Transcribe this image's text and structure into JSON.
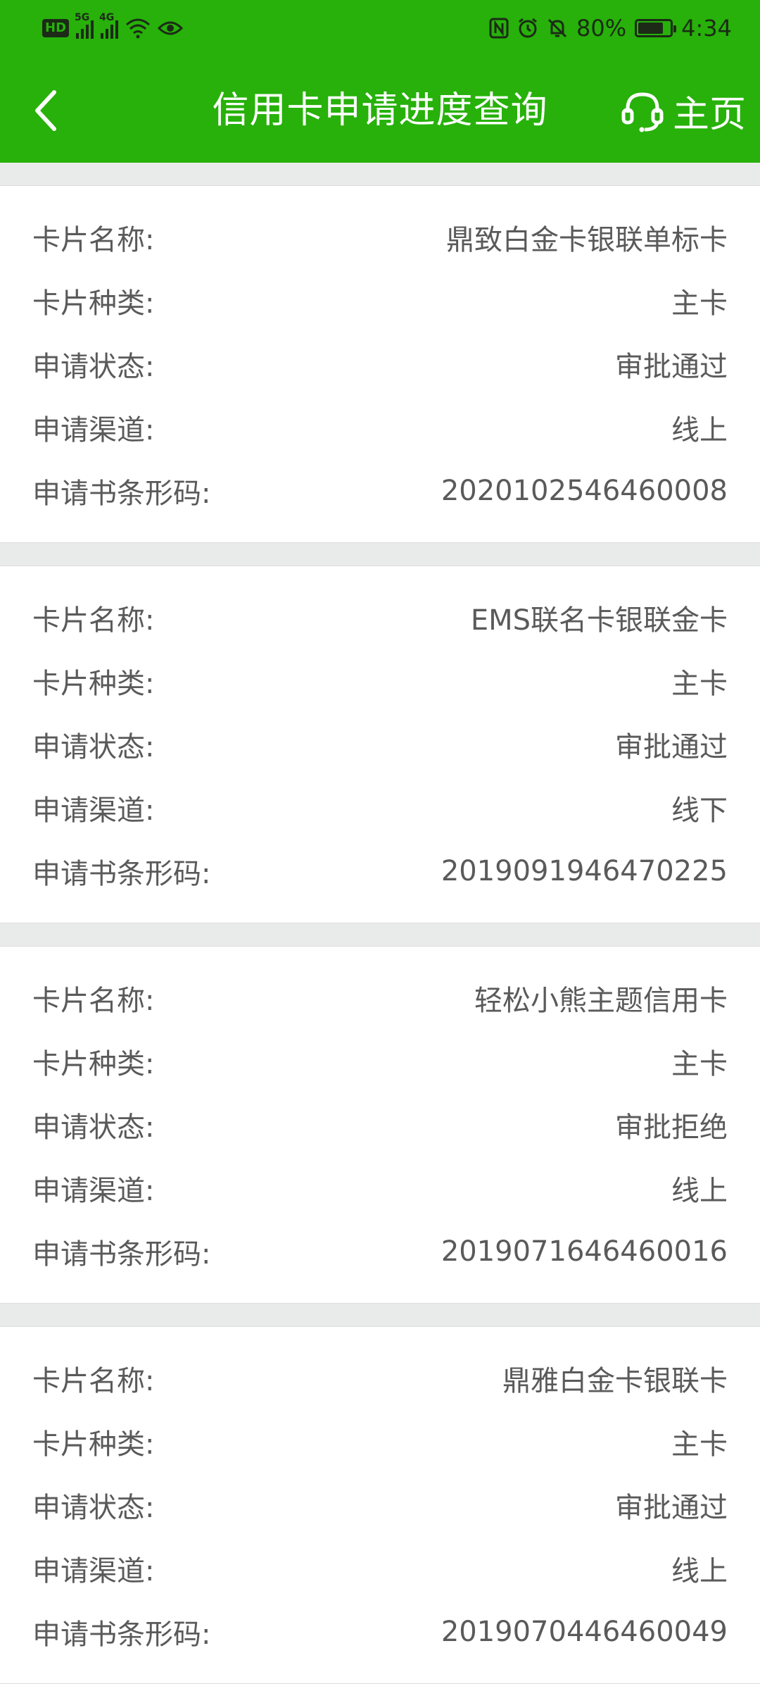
{
  "status_bar": {
    "hd_badge": "HD",
    "signal_1_tag": "5G",
    "signal_2_tag": "4G",
    "battery_percent": "80%",
    "battery_level": 0.8,
    "time": "4:34"
  },
  "header": {
    "title": "信用卡申请进度查询",
    "home_label": "主页",
    "icons": {
      "back": "chevron-left-icon",
      "home": "headset-icon"
    }
  },
  "labels": {
    "card_name": "卡片名称:",
    "card_type": "卡片种类:",
    "status": "申请状态:",
    "channel": "申请渠道:",
    "barcode": "申请书条形码:"
  },
  "cards": [
    {
      "card_name": "鼎致白金卡银联单标卡",
      "card_type": "主卡",
      "status": "审批通过",
      "channel": "线上",
      "barcode": "2020102546460008"
    },
    {
      "card_name": "EMS联名卡银联金卡",
      "card_type": "主卡",
      "status": "审批通过",
      "channel": "线下",
      "barcode": "2019091946470225"
    },
    {
      "card_name": "轻松小熊主题信用卡",
      "card_type": "主卡",
      "status": "审批拒绝",
      "channel": "线上",
      "barcode": "2019071646460016"
    },
    {
      "card_name": "鼎雅白金卡银联卡",
      "card_type": "主卡",
      "status": "审批通过",
      "channel": "线上",
      "barcode": "2019070446460049"
    }
  ],
  "colors": {
    "header_green": "#27b10a",
    "page_bg": "#e9ebea",
    "text_gray": "#5a5a5a"
  }
}
